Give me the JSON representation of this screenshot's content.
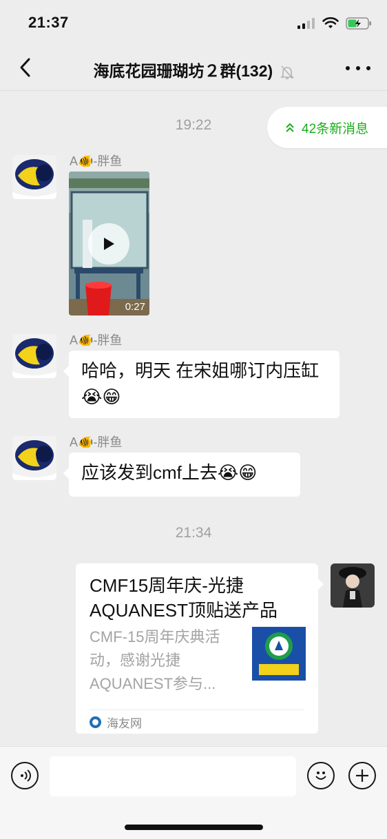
{
  "status_bar": {
    "time": "21:37"
  },
  "nav": {
    "title": "海底花园珊瑚坊２群(132)"
  },
  "new_messages": {
    "label": "42条新消息"
  },
  "messages": {
    "time1": "19:22",
    "msg1": {
      "sender": "A🐠-胖鱼",
      "type": "video",
      "duration": "0:27"
    },
    "msg2": {
      "sender": "A🐠-胖鱼",
      "text": "哈哈，明天 在宋姐哪订内压缸😭😁"
    },
    "msg3": {
      "sender": "A🐠-胖鱼",
      "text": "应该发到cmf上去😭😁"
    },
    "time2": "21:34",
    "msg4": {
      "type": "link_card",
      "title": "CMF15周年庆-光捷AQUANEST顶贴送产品",
      "description": "CMF-15周年庆典活动，感谢光捷AQUANEST参与...",
      "source": "海友网"
    }
  },
  "colors": {
    "accent_green": "#1aad19",
    "background": "#ededed",
    "bubble": "#ffffff"
  },
  "icons": [
    "signal-icon",
    "wifi-icon",
    "battery-icon",
    "back-icon",
    "mute-icon",
    "more-icon",
    "chevron-up-icon",
    "play-icon",
    "voice-icon",
    "emoji-icon",
    "plus-icon"
  ]
}
